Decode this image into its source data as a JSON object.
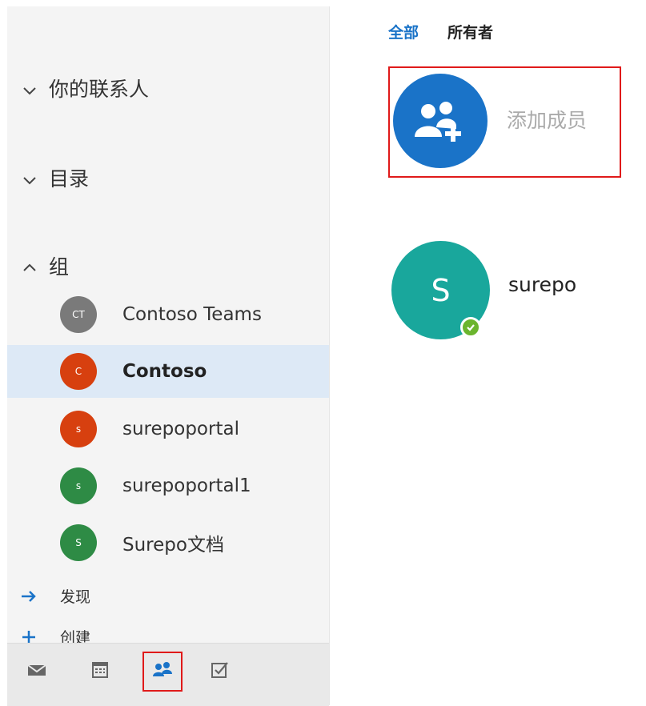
{
  "sidebar": {
    "sections": {
      "contacts": {
        "label": "你的联系人",
        "state": "collapsed"
      },
      "directory": {
        "label": "目录",
        "state": "collapsed"
      },
      "groups": {
        "label": "组",
        "state": "expanded"
      }
    },
    "groups": [
      {
        "initials": "CT",
        "name": "Contoso Teams",
        "color": "#7a7a7a",
        "selected": false
      },
      {
        "initials": "C",
        "name": "Contoso",
        "color": "#d7400f",
        "selected": true
      },
      {
        "initials": "s",
        "name": "surepoportal",
        "color": "#d7400f",
        "selected": false
      },
      {
        "initials": "s",
        "name": "surepoportal1",
        "color": "#2e8b45",
        "selected": false
      },
      {
        "initials": "S",
        "name": "Surepo文档",
        "color": "#2e8b45",
        "selected": false
      }
    ],
    "actions": {
      "discover": {
        "label": "发现",
        "icon": "arrow-right-icon"
      },
      "create": {
        "label": "创建",
        "icon": "plus-icon"
      }
    },
    "bottom_bar": [
      {
        "icon": "mail-icon",
        "active": false
      },
      {
        "icon": "calendar-icon",
        "active": false
      },
      {
        "icon": "people-icon",
        "active": true
      },
      {
        "icon": "tasks-icon",
        "active": false
      }
    ]
  },
  "main": {
    "tabs": [
      {
        "label": "全部",
        "active": true
      },
      {
        "label": "所有者",
        "active": false
      }
    ],
    "add_member": {
      "label": "添加成员",
      "icon": "add-people-icon"
    },
    "members": [
      {
        "initial": "S",
        "name": "surepo",
        "status": "available",
        "color": "#19a79c"
      }
    ]
  },
  "colors": {
    "accent": "#1a73c8",
    "highlight_border": "#e01a1a",
    "selected_row": "#dde9f6",
    "presence": "#6bb52e"
  }
}
